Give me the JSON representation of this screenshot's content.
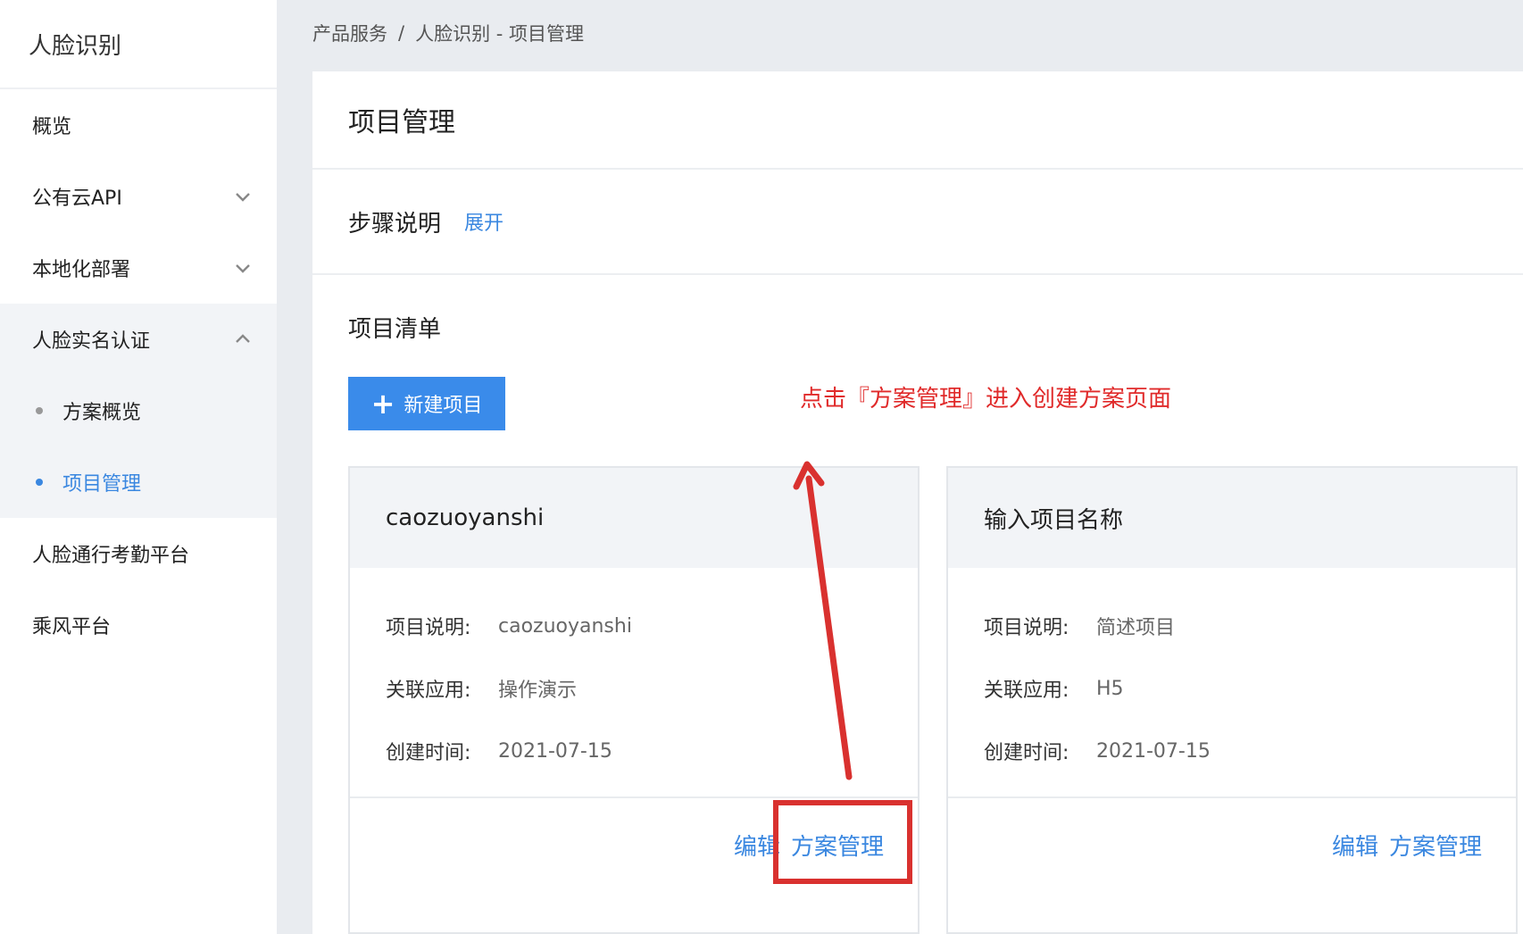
{
  "sidebar": {
    "title": "人脸识别",
    "items": [
      {
        "label": "概览"
      },
      {
        "label": "公有云API"
      },
      {
        "label": "本地化部署"
      },
      {
        "label": "人脸实名认证"
      }
    ],
    "sub_items": [
      {
        "label": "方案概览"
      },
      {
        "label": "项目管理"
      }
    ],
    "bottom_items": [
      {
        "label": "人脸通行考勤平台"
      },
      {
        "label": "乘风平台"
      }
    ]
  },
  "breadcrumb": {
    "root": "产品服务",
    "separator": "/",
    "current": "人脸识别 - 项目管理"
  },
  "page": {
    "title": "项目管理",
    "steps_label": "步骤说明",
    "expand_label": "展开",
    "list_title": "项目清单",
    "new_button": "新建项目"
  },
  "annotation": "点击『方案管理』进入创建方案页面",
  "cards": [
    {
      "name": "caozuoyanshi",
      "desc_label": "项目说明:",
      "desc": "caozuoyanshi",
      "app_label": "关联应用:",
      "app": "操作演示",
      "date_label": "创建时间:",
      "date": "2021-07-15",
      "edit": "编辑",
      "manage": "方案管理"
    },
    {
      "name": "输入项目名称",
      "desc_label": "项目说明:",
      "desc": "简述项目",
      "app_label": "关联应用:",
      "app": "H5",
      "date_label": "创建时间:",
      "date": "2021-07-15",
      "edit": "编辑",
      "manage": "方案管理"
    }
  ],
  "colors": {
    "accent": "#3a87e0",
    "annotation": "#e02a2a",
    "highlight": "#d9312f"
  }
}
